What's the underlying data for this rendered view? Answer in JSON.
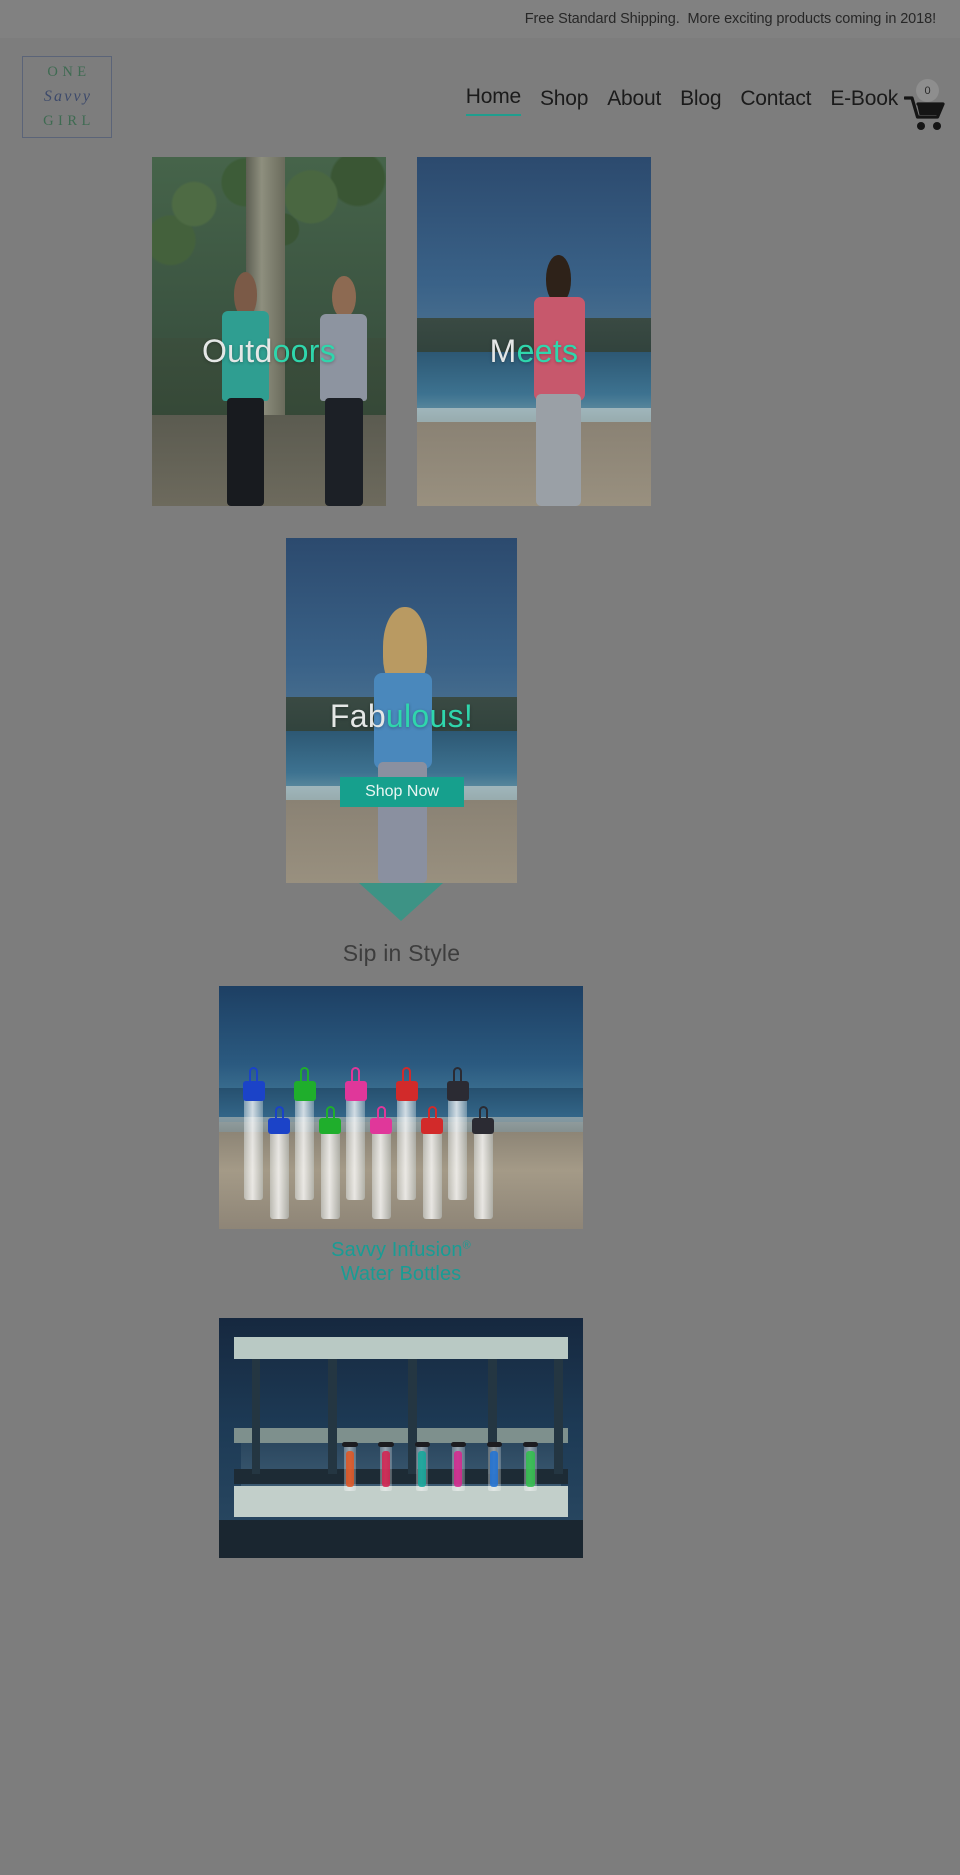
{
  "announcement": {
    "text": "Free Standard Shipping.  More exciting products coming in 2018!"
  },
  "header": {
    "logo": {
      "line1": "ONE",
      "line2": "Savvy",
      "line3": "GIRL",
      "line1_color": "#3f6b52",
      "line2_color": "#3d4a6b",
      "border_color": "#5b6478"
    },
    "nav": [
      {
        "label": "Home",
        "name": "nav-item-home",
        "active": true
      },
      {
        "label": "Shop",
        "name": "nav-item-shop",
        "active": false
      },
      {
        "label": "About",
        "name": "nav-item-about",
        "active": false
      },
      {
        "label": "Blog",
        "name": "nav-item-blog",
        "active": false
      },
      {
        "label": "Contact",
        "name": "nav-item-contact",
        "active": false
      },
      {
        "label": "E-Book",
        "name": "nav-item-ebook",
        "active": false
      }
    ],
    "cart": {
      "icon": "shopping-cart-icon",
      "count": "0"
    },
    "active_underline_color": "#1f9e8e"
  },
  "hero": {
    "tile_left": {
      "overlay_white": "Outd",
      "overlay_teal": "oors",
      "alt": "two women jogging outdoors with infusion water bottles"
    },
    "tile_right": {
      "overlay_white": "M",
      "overlay_teal": "eets",
      "alt": "woman on beach drinking from infusion water bottle"
    },
    "tile_center": {
      "overlay_white": "Fab",
      "overlay_teal": "ulous!",
      "button_label": "Shop Now",
      "button_color": "#16a08d",
      "alt": "woman on beach holding green infusion water bottle"
    }
  },
  "arrow": {
    "name": "down-arrow-divider",
    "color": "#3d9385"
  },
  "section": {
    "title": "Sip in Style",
    "title_color": "#3d3d3d"
  },
  "products": [
    {
      "name": "product-savvy-infusion-water-bottles",
      "caption_line1": "Savvy Infusion",
      "caption_superscript": "®",
      "caption_line2": "Water Bottles",
      "caption_color": "#199c94",
      "alt": "ten clear infusion water bottles with colored caps standing in beach sand",
      "cap_colors": [
        "#1b43c8",
        "#1fae2c",
        "#e0379a",
        "#d22a2a",
        "#2b2b33",
        "#1b43c8",
        "#1fae2c",
        "#e0379a",
        "#d22a2a",
        "#2b2b33"
      ]
    },
    {
      "name": "product-bottles-on-pier",
      "alt": "row of colorful infused water bottles on a blue wooden pier railing",
      "infusion_colors": [
        "#e2541f",
        "#d61f4e",
        "#11a79a",
        "#d6258e",
        "#1f72d6",
        "#2fbf4a"
      ]
    }
  ],
  "colors": {
    "page_overlay": "#7d7d7d",
    "teal_accent": "#2fd6ac",
    "teal_button": "#16a08d",
    "teal_link": "#199c94"
  }
}
